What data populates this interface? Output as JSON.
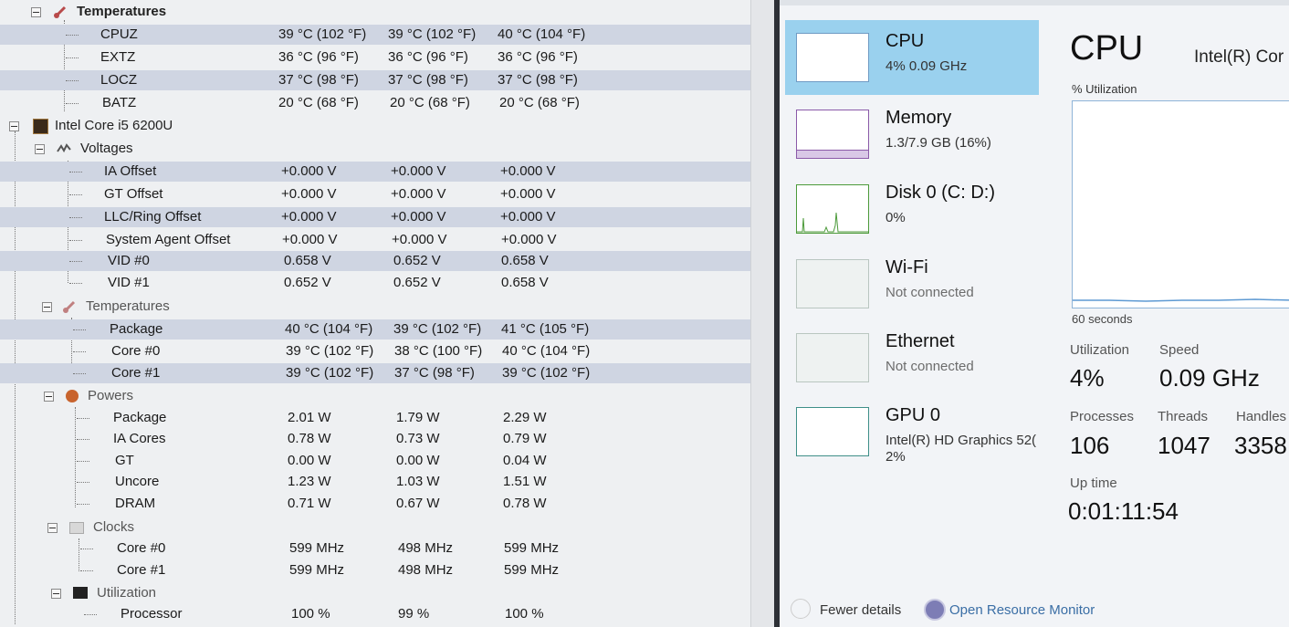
{
  "hwmonitor": {
    "battery_temps": {
      "label": "Temperatures",
      "rows": [
        {
          "name": "CPUZ",
          "v": [
            "39 °C (102 °F)",
            "39 °C (102 °F)",
            "40 °C (104 °F)"
          ]
        },
        {
          "name": "EXTZ",
          "v": [
            "36 °C (96 °F)",
            "36 °C (96 °F)",
            "36 °C (96 °F)"
          ]
        },
        {
          "name": "LOCZ",
          "v": [
            "37 °C (98 °F)",
            "37 °C (98 °F)",
            "37 °C (98 °F)"
          ]
        },
        {
          "name": "BATZ",
          "v": [
            "20 °C (68 °F)",
            "20 °C (68 °F)",
            "20 °C (68 °F)"
          ]
        }
      ]
    },
    "device": "Intel Core i5 6200U",
    "voltages": {
      "label": "Voltages",
      "rows": [
        {
          "name": "IA Offset",
          "v": [
            "+0.000 V",
            "+0.000 V",
            "+0.000 V"
          ]
        },
        {
          "name": "GT Offset",
          "v": [
            "+0.000 V",
            "+0.000 V",
            "+0.000 V"
          ]
        },
        {
          "name": "LLC/Ring Offset",
          "v": [
            "+0.000 V",
            "+0.000 V",
            "+0.000 V"
          ]
        },
        {
          "name": "System Agent Offset",
          "v": [
            "+0.000 V",
            "+0.000 V",
            "+0.000 V"
          ]
        },
        {
          "name": "VID #0",
          "v": [
            "0.658 V",
            "0.652 V",
            "0.658 V"
          ]
        },
        {
          "name": "VID #1",
          "v": [
            "0.652 V",
            "0.652 V",
            "0.658 V"
          ]
        }
      ]
    },
    "temperatures": {
      "label": "Temperatures",
      "rows": [
        {
          "name": "Package",
          "v": [
            "40 °C (104 °F)",
            "39 °C (102 °F)",
            "41 °C (105 °F)"
          ]
        },
        {
          "name": "Core #0",
          "v": [
            "39 °C (102 °F)",
            "38 °C (100 °F)",
            "40 °C (104 °F)"
          ]
        },
        {
          "name": "Core #1",
          "v": [
            "39 °C (102 °F)",
            "37 °C (98 °F)",
            "39 °C (102 °F)"
          ]
        }
      ]
    },
    "powers": {
      "label": "Powers",
      "rows": [
        {
          "name": "Package",
          "v": [
            "2.01 W",
            "1.79 W",
            "2.29 W"
          ]
        },
        {
          "name": "IA Cores",
          "v": [
            "0.78 W",
            "0.73 W",
            "0.79 W"
          ]
        },
        {
          "name": "GT",
          "v": [
            "0.00 W",
            "0.00 W",
            "0.04 W"
          ]
        },
        {
          "name": "Uncore",
          "v": [
            "1.23 W",
            "1.03 W",
            "1.51 W"
          ]
        },
        {
          "name": "DRAM",
          "v": [
            "0.71 W",
            "0.67 W",
            "0.78 W"
          ]
        }
      ]
    },
    "clocks": {
      "label": "Clocks",
      "rows": [
        {
          "name": "Core #0",
          "v": [
            "599 MHz",
            "498 MHz",
            "599 MHz"
          ]
        },
        {
          "name": "Core #1",
          "v": [
            "599 MHz",
            "498 MHz",
            "599 MHz"
          ]
        }
      ]
    },
    "utilization": {
      "label": "Utilization",
      "rows": [
        {
          "name": "Processor",
          "v": [
            "100 %",
            "99 %",
            "100 %"
          ]
        }
      ]
    }
  },
  "taskmgr": {
    "items": {
      "cpu": {
        "title": "CPU",
        "sub": "4% 0.09 GHz"
      },
      "memory": {
        "title": "Memory",
        "sub": "1.3/7.9 GB (16%)"
      },
      "disk": {
        "title": "Disk 0 (C: D:)",
        "sub": "0%"
      },
      "wifi": {
        "title": "Wi-Fi",
        "sub": "Not connected"
      },
      "ethernet": {
        "title": "Ethernet",
        "sub": "Not connected"
      },
      "gpu": {
        "title": "GPU 0",
        "sub": "Intel(R) HD Graphics 52(",
        "sub2": "2%"
      }
    },
    "detail": {
      "title": "CPU",
      "model": "Intel(R) Cor",
      "util_label": "% Utilization",
      "time_label": "60 seconds",
      "utilization_label": "Utilization",
      "utilization": "4%",
      "speed_label": "Speed",
      "speed": "0.09 GHz",
      "processes_label": "Processes",
      "processes": "106",
      "threads_label": "Threads",
      "threads": "1047",
      "handles_label": "Handles",
      "handles": "3358",
      "uptime_label": "Up time",
      "uptime": "0:01:11:54"
    },
    "footer": {
      "fewer": "Fewer details",
      "monitor": "Open Resource Monitor"
    }
  }
}
